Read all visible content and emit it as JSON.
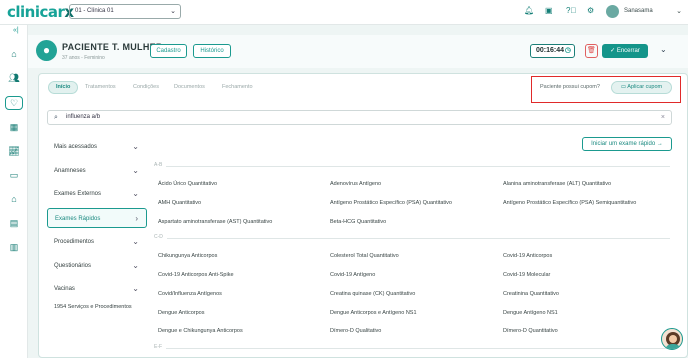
{
  "app": {
    "logo": "clinicar",
    "logo_x": "x"
  },
  "topbar": {
    "clinic_select": "01 - Clínica 01",
    "user_name": "Sanasama"
  },
  "patient": {
    "name": "PACIENTE T. MULHER",
    "subtitle": "37 anos - Feminino",
    "cadastro_label": "Cadastro",
    "historico_label": "Histórico",
    "timer": "00:16:44",
    "encerrar_label": "Encerrar"
  },
  "tabs": [
    {
      "label": "Início"
    },
    {
      "label": "Tratamentos"
    },
    {
      "label": "Condições"
    },
    {
      "label": "Documentos"
    },
    {
      "label": "Fechamento"
    }
  ],
  "coupon": {
    "question": "Paciente possui cupom?",
    "button_label": "Aplicar cupom"
  },
  "search": {
    "value": "influenza a/b"
  },
  "categories": [
    {
      "label": "Mais acessados"
    },
    {
      "label": "Anamneses"
    },
    {
      "label": "Exames Externos"
    },
    {
      "label": "Exames Rápidos"
    },
    {
      "label": "Procedimentos"
    },
    {
      "label": "Questionários"
    },
    {
      "label": "Vacinas"
    }
  ],
  "services_count": "1954 Serviços e Procedimentos",
  "quick_exam_label": "Iniciar um exame rápido",
  "groups": [
    {
      "label": "A-B",
      "items": [
        "Ácido Úrico Quantitativo",
        "Adenovírus Antígeno",
        "Alanina aminotransferase (ALT) Quantitativo",
        "AMH Quantitativo",
        "Antígeno Prostático Específico (PSA) Quantitativo",
        "Antígeno Prostático Específico (PSA) Semiquantitativo",
        "Aspartato aminotransferase (AST) Quantitativo",
        "Beta-HCG Quantitativo"
      ]
    },
    {
      "label": "C-D",
      "items": [
        "Chikungunya Anticorpos",
        "Colesterol Total Quantitativo",
        "Covid-19 Anticorpos",
        "Covid-19 Anticorpos Anti-Spike",
        "Covid-19 Antígeno",
        "Covid-19 Molecular",
        "Covid/Influenza Antígenos",
        "Creatina quinase (CK) Quantitativo",
        "Creatinina Quantitativo",
        "Dengue Anticorpos",
        "Dengue Anticorpos e Antígeno NS1",
        "Dengue Antígeno NS1",
        "Dengue e Chikungunya Anticorpos",
        "Dímero-D Qualitativo",
        "Dímero-D Quantitativo"
      ]
    },
    {
      "label": "E-F",
      "items": []
    }
  ],
  "colors": {
    "accent": "#1b9a8f",
    "highlight_box": "#e02a2a",
    "trash": "#e04848"
  },
  "icons": [
    "bell-icon",
    "briefcase-icon",
    "help-icon",
    "gear-icon",
    "home-icon",
    "users-icon",
    "stethoscope-icon",
    "calendar-icon",
    "chart-icon",
    "folder-icon",
    "bank-icon",
    "id-card-icon",
    "report-icon",
    "clock-icon",
    "trash-icon",
    "ticket-icon",
    "search-icon",
    "arrow-right-icon"
  ]
}
